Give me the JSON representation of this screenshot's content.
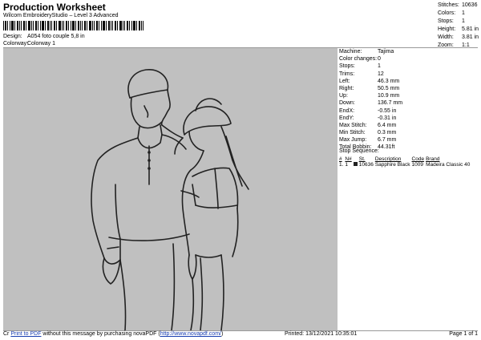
{
  "header": {
    "title": "Production Worksheet",
    "subtitle": "Wilcom EmbroideryStudio – Level 3 Advanced",
    "design_label": "Design:",
    "design_value": "A054 foto couple 5,8 in",
    "colorway_label": "Colorway:",
    "colorway_value": "Colorway 1"
  },
  "stats": [
    {
      "k": "Stitches:",
      "v": "10636"
    },
    {
      "k": "Colors:",
      "v": "1"
    },
    {
      "k": "Stops:",
      "v": "1"
    },
    {
      "k": "Height:",
      "v": "5.81 in"
    },
    {
      "k": "Width:",
      "v": "3.81 in"
    },
    {
      "k": "Zoom:",
      "v": "1:1"
    }
  ],
  "details": [
    {
      "k": "Machine:",
      "v": "Tajima"
    },
    {
      "k": "Color changes:",
      "v": "0"
    },
    {
      "k": "Stops:",
      "v": "1"
    },
    {
      "k": "Trims:",
      "v": "12"
    },
    {
      "k": "Left:",
      "v": "46.3 mm"
    },
    {
      "k": "Right:",
      "v": "50.5 mm"
    },
    {
      "k": "Up:",
      "v": "10.9 mm"
    },
    {
      "k": "Down:",
      "v": "136.7 mm"
    },
    {
      "k": "EndX:",
      "v": "-0.55 in"
    },
    {
      "k": "EndY:",
      "v": "-0.31 in"
    },
    {
      "k": "Max Stitch:",
      "v": "6.4 mm"
    },
    {
      "k": "Min Stitch:",
      "v": "0.3 mm"
    },
    {
      "k": "Max Jump:",
      "v": "6.7 mm"
    },
    {
      "k": "Total Bobbin:",
      "v": "44.31ft"
    }
  ],
  "stop_sequence": {
    "header": "Stop Sequence:",
    "columns": [
      "#",
      "N#",
      "St.",
      "Description",
      "Code",
      "Brand"
    ],
    "rows": [
      {
        "num": "1.",
        "n": "1",
        "st": "10636",
        "desc": "Sapphire Black",
        "code": "1009",
        "brand": "Madeira Classic 40",
        "color": "#222222"
      }
    ]
  },
  "footer": {
    "prefix": "Cr",
    "link1": "Print to PDF",
    "text": " without this message by purchasing novaPDF (",
    "link2": "http://www.novapdf.com/",
    "suffix": ")",
    "printed": "Printed: 13/12/2021 10:35:01",
    "page": "Page 1 of 1"
  }
}
